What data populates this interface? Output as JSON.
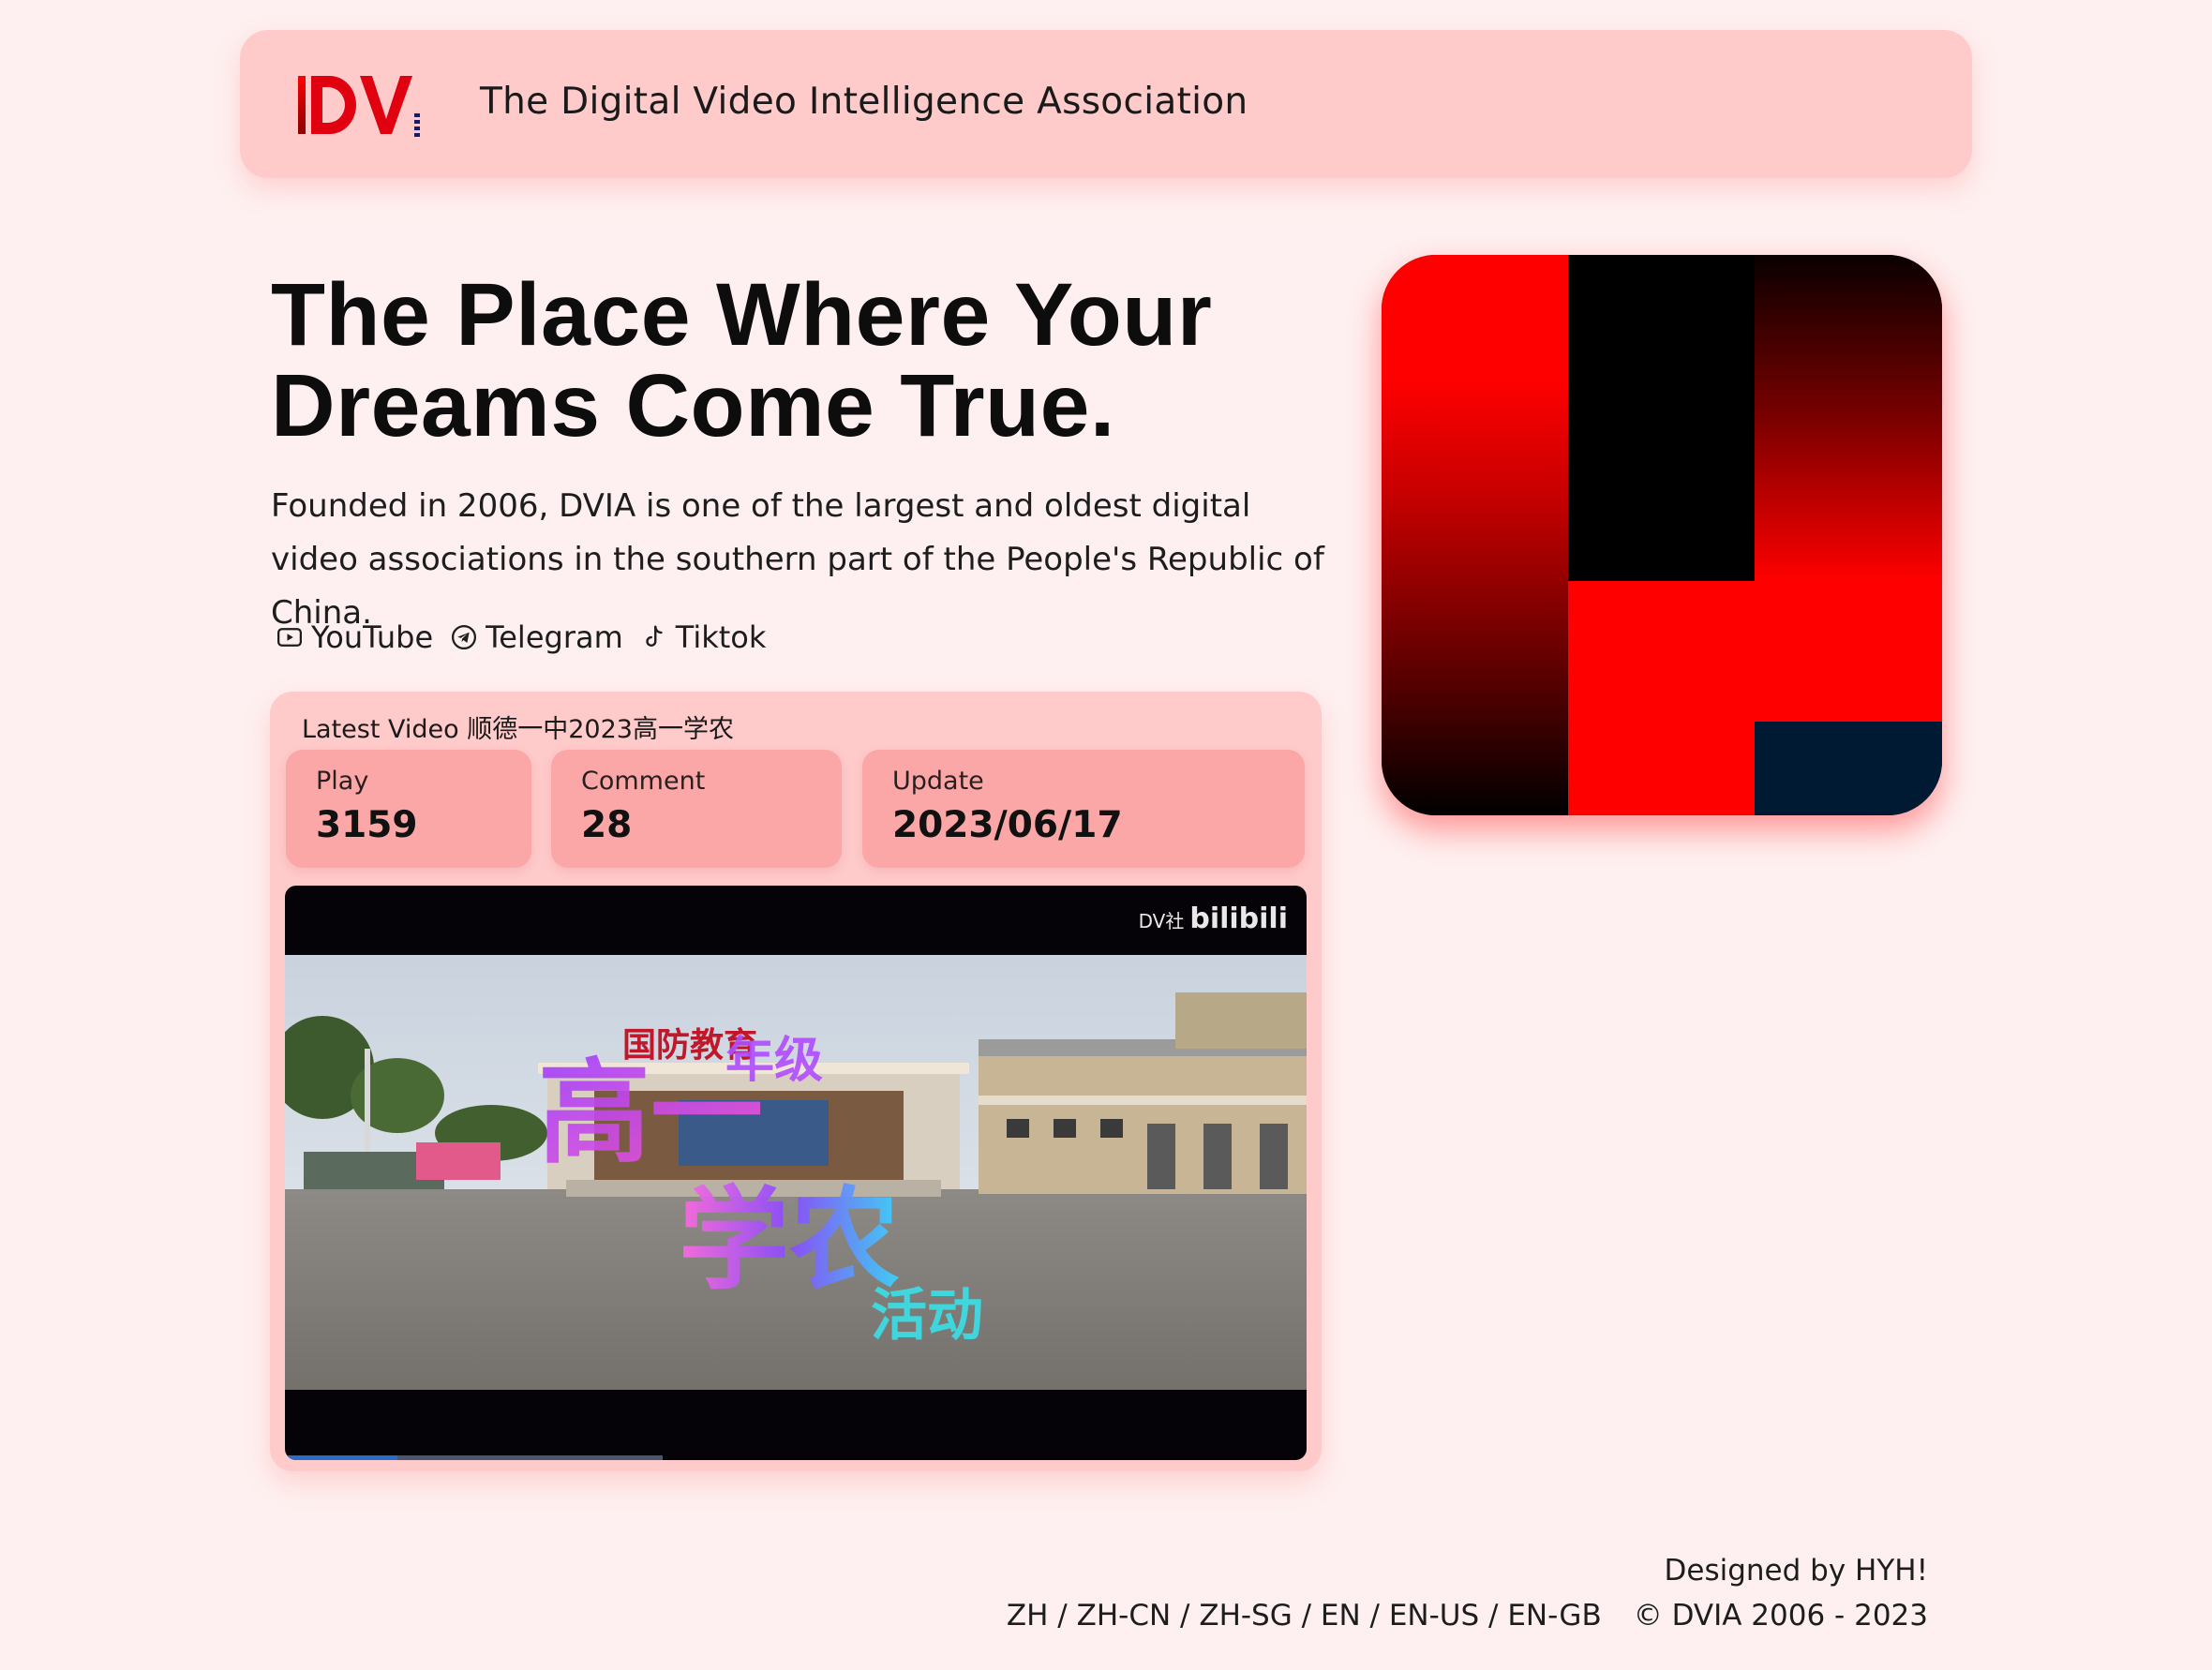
{
  "header": {
    "logo_text": "DV",
    "title": "The Digital Video Intelligence Association"
  },
  "hero": {
    "title": "The Place Where Your Dreams Come True.",
    "description": "Founded in 2006, DVIA is one of the largest and oldest digital video associations in the southern part of the People's Republic of China."
  },
  "social": [
    {
      "label": "YouTube",
      "icon": "youtube-icon"
    },
    {
      "label": "Telegram",
      "icon": "telegram-icon"
    },
    {
      "label": "Tiktok",
      "icon": "tiktok-icon"
    }
  ],
  "latest_video": {
    "label": "Latest Video 顺德一中2023高一学农",
    "stats": [
      {
        "label": "Play",
        "value": "3159"
      },
      {
        "label": "Comment",
        "value": "28"
      },
      {
        "label": "Update",
        "value": "2023/06/17"
      }
    ],
    "player": {
      "watermark_prefix": "DV社",
      "watermark_brand": "bilibili",
      "frame_sign": "国防教育",
      "frame_overlay": [
        "高一",
        "年级",
        "学农",
        "活动"
      ],
      "progress_played": 0.11,
      "progress_buffered": 0.37
    }
  },
  "footer": {
    "credit": "Designed by HYH!",
    "languages": "ZH / ZH-CN / ZH-SG / EN / EN-US / EN-GB",
    "copyright": "© DVIA 2006 - 2023"
  },
  "colors": {
    "page_bg": "#fef0f0",
    "card_bg": "#ffcaca",
    "stat_bg": "#fba7a7",
    "brand_red": "#ff0000",
    "navy": "#001a33"
  }
}
